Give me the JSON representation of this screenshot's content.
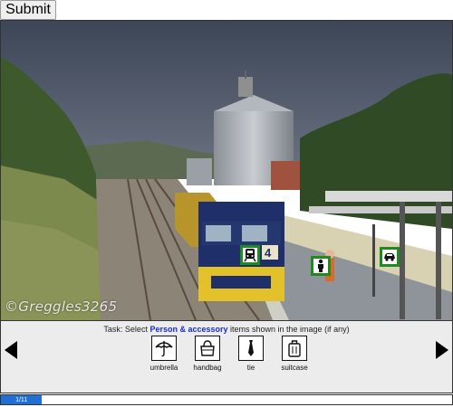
{
  "toolbar": {
    "submit_label": "Submit"
  },
  "image": {
    "watermark": "©Greggles3265",
    "train_number": "4",
    "markers": [
      {
        "icon": "train-icon",
        "selected": true
      },
      {
        "icon": "person-icon",
        "selected": true
      },
      {
        "icon": "car-icon",
        "selected": true
      }
    ]
  },
  "task": {
    "prefix": "Task: Select ",
    "category": "Person & accessory",
    "suffix": " items shown in the image (if any)"
  },
  "options": [
    {
      "label": "umbrella",
      "icon": "umbrella-icon"
    },
    {
      "label": "handbag",
      "icon": "handbag-icon"
    },
    {
      "label": "tie",
      "icon": "tie-icon"
    },
    {
      "label": "suitcase",
      "icon": "suitcase-icon"
    }
  ],
  "progress": {
    "text": "1/11",
    "current": 1,
    "total": 11
  },
  "colors": {
    "accent": "#1e6fd6",
    "marker": "#1f8a1f",
    "category": "#1a2ec8"
  }
}
